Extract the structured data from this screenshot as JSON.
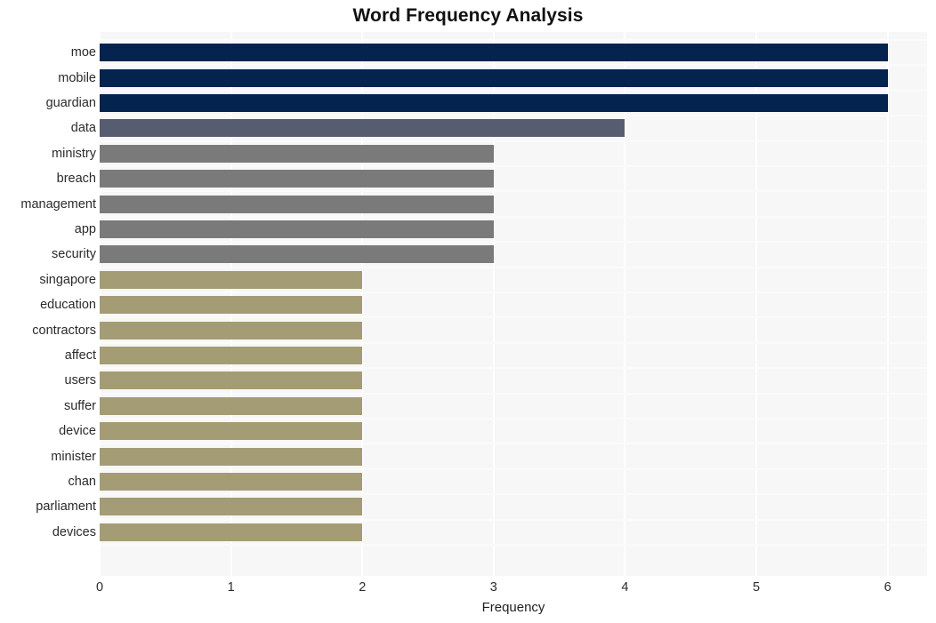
{
  "chart_data": {
    "type": "bar",
    "orientation": "horizontal",
    "title": "Word Frequency Analysis",
    "xlabel": "Frequency",
    "ylabel": "",
    "xlim": [
      0,
      6.3
    ],
    "xticks": [
      0,
      1,
      2,
      3,
      4,
      5,
      6
    ],
    "xtick_labels": [
      "0",
      "1",
      "2",
      "3",
      "4",
      "5",
      "6"
    ],
    "grid": true,
    "legend": null,
    "categories": [
      "moe",
      "mobile",
      "guardian",
      "data",
      "ministry",
      "breach",
      "management",
      "app",
      "security",
      "singapore",
      "education",
      "contractors",
      "affect",
      "users",
      "suffer",
      "device",
      "minister",
      "chan",
      "parliament",
      "devices"
    ],
    "values": [
      6,
      6,
      6,
      4,
      3,
      3,
      3,
      3,
      3,
      2,
      2,
      2,
      2,
      2,
      2,
      2,
      2,
      2,
      2,
      2
    ],
    "bar_colors": [
      "#04234f",
      "#04234f",
      "#04234f",
      "#575d70",
      "#7a7a7a",
      "#7a7a7a",
      "#7a7a7a",
      "#7a7a7a",
      "#7a7a7a",
      "#a49c74",
      "#a49c74",
      "#a49c74",
      "#a49c74",
      "#a49c74",
      "#a49c74",
      "#a49c74",
      "#a49c74",
      "#a49c74",
      "#a49c74",
      "#a49c74"
    ],
    "plot_background": "#f7f7f7",
    "gridline_color": "#ffffff",
    "figure_background": "#ffffff"
  }
}
